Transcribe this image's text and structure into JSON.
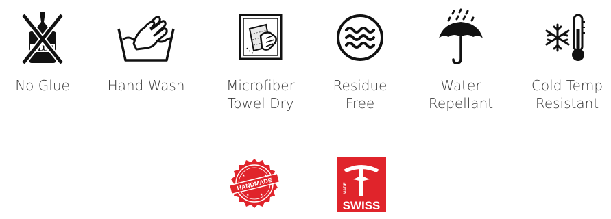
{
  "features": [
    {
      "icon": "no-glue-icon",
      "line1": "No Glue",
      "line2": "",
      "icon_text": "GLUE"
    },
    {
      "icon": "hand-wash-icon",
      "line1": "Hand Wash",
      "line2": ""
    },
    {
      "icon": "microfiber-towel-icon",
      "line1": "Microfiber",
      "line2": "Towel Dry"
    },
    {
      "icon": "residue-free-icon",
      "line1": "Residue",
      "line2": "Free"
    },
    {
      "icon": "umbrella-rain-icon",
      "line1": "Water",
      "line2": "Repellant"
    },
    {
      "icon": "snowflake-thermometer-icon",
      "line1": "Cold Temp",
      "line2": "Resistant"
    }
  ],
  "badges": {
    "handmade": {
      "icon": "handmade-seal-icon",
      "text": "HANDMADE",
      "color": "#e0242b"
    },
    "swiss": {
      "icon": "swiss-made-icon",
      "small_text": "MADE",
      "big_text": "SWISS",
      "color": "#e0242b"
    }
  }
}
